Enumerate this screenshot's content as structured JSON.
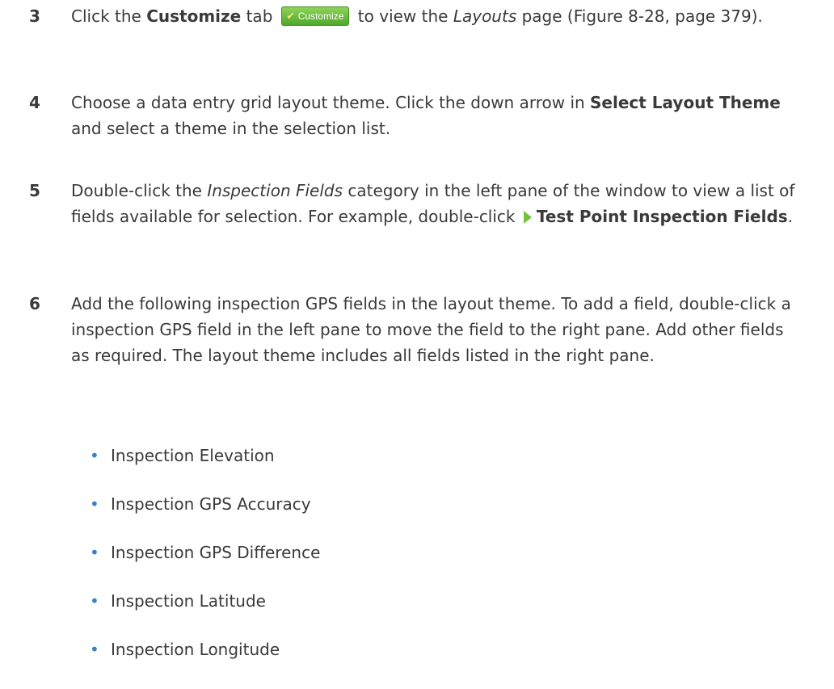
{
  "steps": [
    {
      "num": "3",
      "t1": "Click the ",
      "b1": "Customize",
      "t2": " tab ",
      "tab_label": "Customize",
      "t3": " to view the ",
      "i1": "Layouts",
      "t4": " page (Figure 8-28, page 379)."
    },
    {
      "num": "4",
      "t1": "Choose a data entry grid layout theme. Click the down arrow in ",
      "b1": "Select Layout Theme",
      "t2": " and select a theme in the selection list."
    },
    {
      "num": "5",
      "t1": "Double-click the ",
      "i1": "Inspection Fields",
      "t2": " category in the left pane of the window to view a list of fields available for selection. For example, double-click ",
      "b1": "Test Point Inspection Fields",
      "t3": "."
    },
    {
      "num": "6",
      "text": "Add the following inspection GPS fields in the layout theme. To add a field, double-click a inspection GPS field in the left pane to move the field to the right pane. Add other fields as required. The layout theme includes all fields listed in the right pane."
    }
  ],
  "bullets": [
    "Inspection Elevation",
    "Inspection GPS Accuracy",
    "Inspection GPS Difference",
    "Inspection Latitude",
    "Inspection Longitude"
  ],
  "icons": {
    "customize_tab": "wrench-icon",
    "expand": "triangle-right-icon"
  },
  "colors": {
    "text": "#3a3a3a",
    "bullet": "#3f7fc8",
    "tab_green": "#4ea92a"
  }
}
